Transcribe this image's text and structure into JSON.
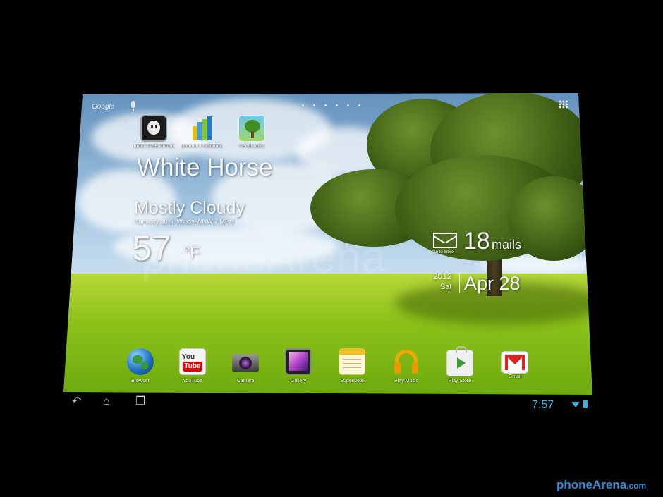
{
  "top_bar": {
    "search_label": "Google",
    "page_dots": 6
  },
  "desktop_apps": [
    {
      "label": "Jump to Benchmark"
    },
    {
      "label": "Quadrant Standard"
    },
    {
      "label": "NenaMark2"
    }
  ],
  "weather": {
    "city": "White Horse",
    "condition": "Mostly Cloudy",
    "details": "Humidity 30%, Winds WNW 7 MPH",
    "temperature": "57",
    "unit": "°F"
  },
  "mail": {
    "count": "18",
    "word": "mails",
    "link": "Go to Inbox"
  },
  "date": {
    "year": "2012",
    "weekday": "Sat",
    "date": "Apr 28"
  },
  "dock": [
    {
      "label": "Browser"
    },
    {
      "label": "YouTube"
    },
    {
      "label": "Camera"
    },
    {
      "label": "Gallery"
    },
    {
      "label": "SuperNote"
    },
    {
      "label": "Play Music"
    },
    {
      "label": "Play Store"
    },
    {
      "label": "Gmail"
    }
  ],
  "system_bar": {
    "time": "7:57",
    "accent_color": "#33b5e5"
  },
  "watermark": {
    "center_text": "phoneArena",
    "brand": "phoneArena",
    "suffix": ".com"
  }
}
